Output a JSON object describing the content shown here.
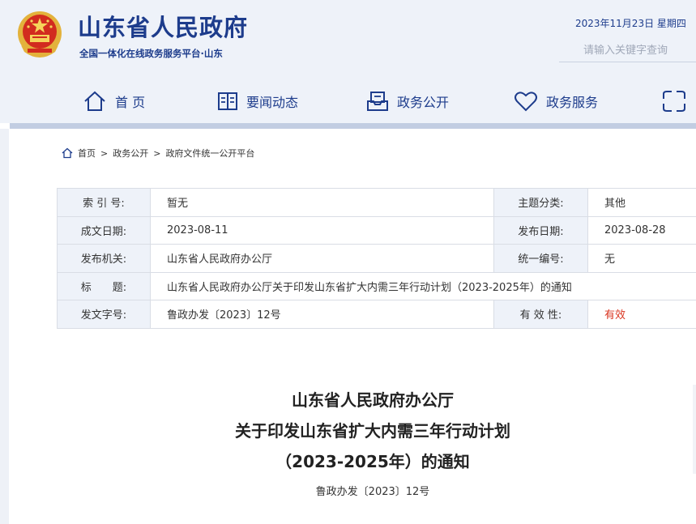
{
  "header": {
    "site_title": "山东省人民政府",
    "site_subtitle": "全国一体化在线政务服务平台·山东",
    "date": "2023年11月23日 星期四",
    "search_placeholder": "请输入关键字查询",
    "emblem_icon": "national-emblem-icon"
  },
  "nav": {
    "items": [
      {
        "label": "首 页",
        "icon": "home-icon"
      },
      {
        "label": "要闻动态",
        "icon": "news-icon"
      },
      {
        "label": "政务公开",
        "icon": "inbox-icon"
      },
      {
        "label": "政务服务",
        "icon": "heart-icon"
      }
    ]
  },
  "breadcrumb": {
    "icon": "home-icon",
    "home": "首页",
    "sep1": ">",
    "level1": "政务公开",
    "sep2": ">",
    "level2": "政府文件统一公开平台"
  },
  "meta_table": {
    "index_no_label": "索 引 号:",
    "index_no": "暂无",
    "topic_label": "主题分类:",
    "topic": "其他",
    "written_date_label": "成文日期:",
    "written_date": "2023-08-11",
    "publish_date_label": "发布日期:",
    "publish_date": "2023-08-28",
    "issuer_label": "发布机关:",
    "issuer": "山东省人民政府办公厅",
    "unified_no_label": "统一编号:",
    "unified_no": "无",
    "title_label": "标　　题:",
    "title": "山东省人民政府办公厅关于印发山东省扩大内需三年行动计划（2023-2025年）的通知",
    "doc_no_label": "发文字号:",
    "doc_no": "鲁政办发〔2023〕12号",
    "validity_label": "有 效 性:",
    "validity": "有效"
  },
  "document": {
    "title_line1": "山东省人民政府办公厅",
    "title_line2": "关于印发山东省扩大内需三年行动计划",
    "title_line3": "（2023-2025年）的通知",
    "doc_no": "鲁政办发〔2023〕12号"
  },
  "colors": {
    "brand": "#1d3c8c",
    "header_bg": "#eef2f9",
    "valid_red": "#d9341f"
  }
}
